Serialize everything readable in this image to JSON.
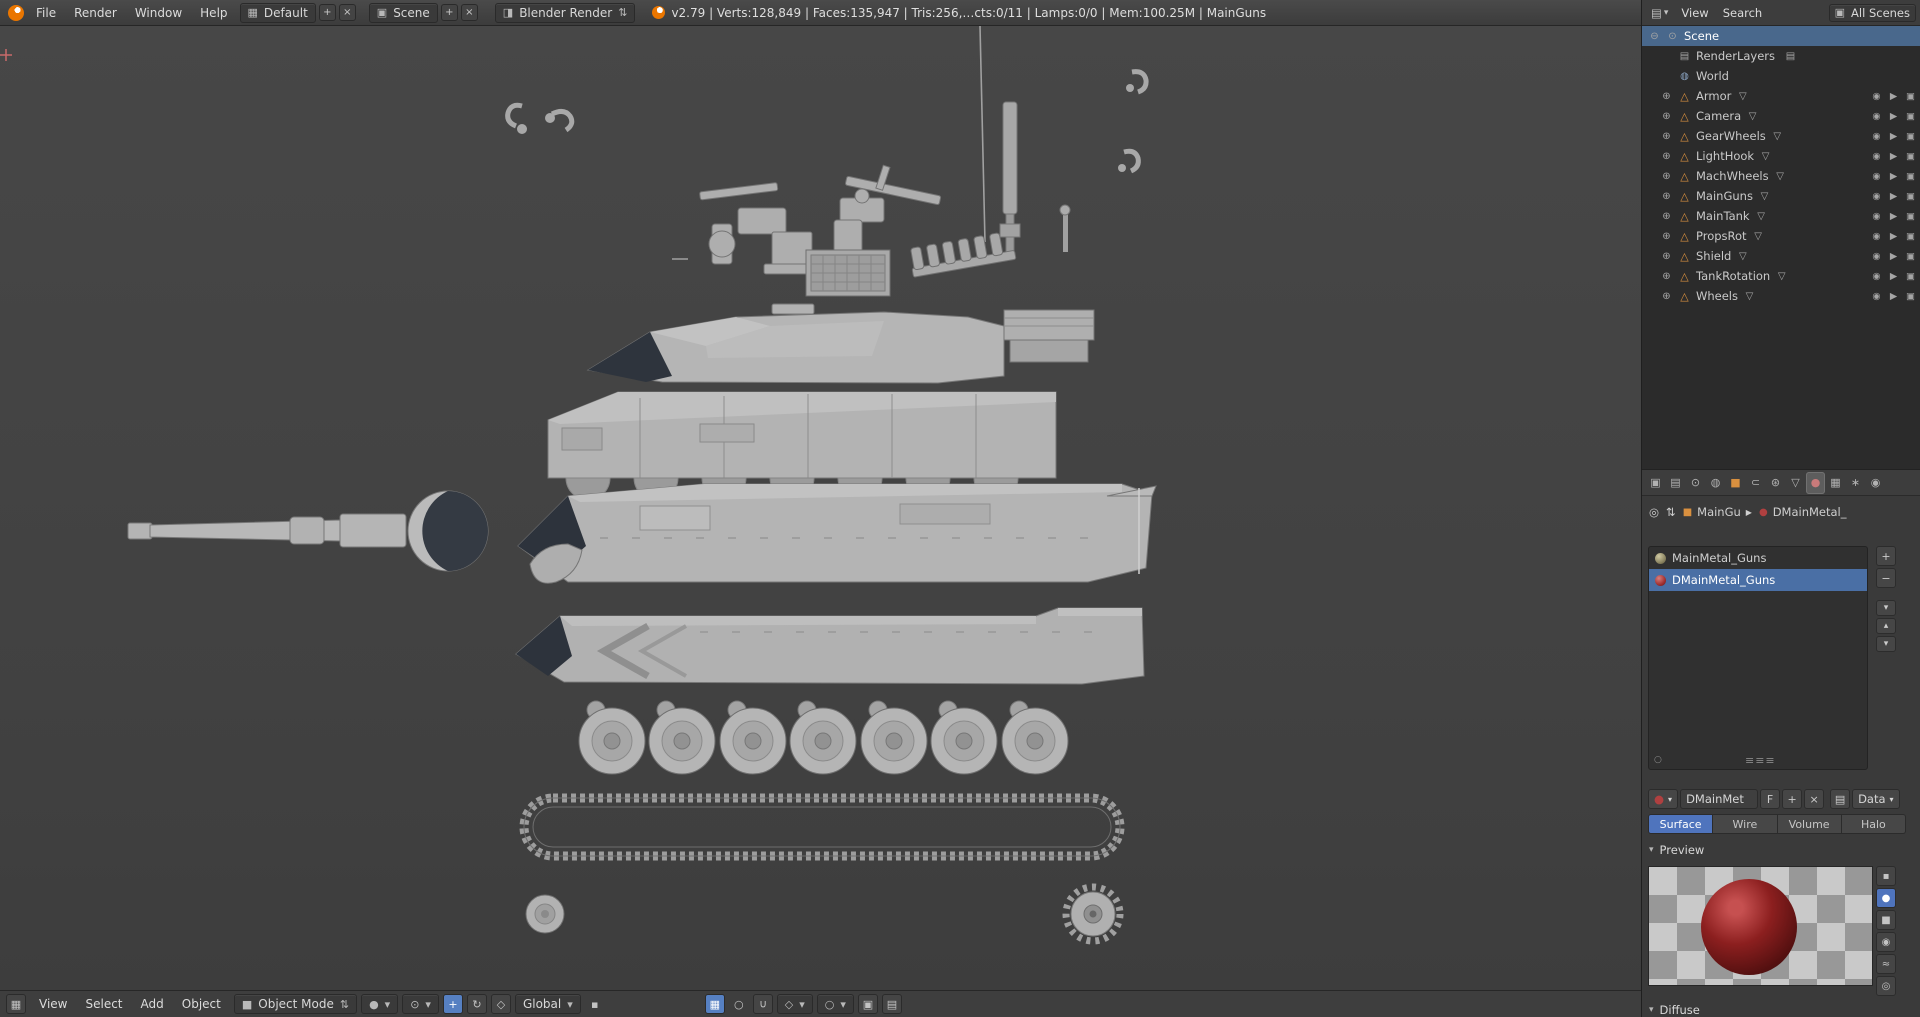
{
  "info_header": {
    "menus": [
      "File",
      "Render",
      "Window",
      "Help"
    ],
    "layout_value": "Default",
    "scene_value": "Scene",
    "engine_value": "Blender Render",
    "stats": "v2.79 | Verts:128,849 | Faces:135,947 | Tris:256,…cts:0/11 | Lamps:0/0 | Mem:100.25M | MainGuns"
  },
  "outliner": {
    "header": {
      "view": "View",
      "search": "Search",
      "scope": "All Scenes"
    },
    "scene": {
      "label": "Scene"
    },
    "children": [
      {
        "label": "RenderLayers"
      },
      {
        "label": "World"
      }
    ],
    "objects": [
      {
        "label": "Armor"
      },
      {
        "label": "Camera"
      },
      {
        "label": "GearWheels"
      },
      {
        "label": "LightHook"
      },
      {
        "label": "MachWheels"
      },
      {
        "label": "MainGuns"
      },
      {
        "label": "MainTank"
      },
      {
        "label": "PropsRot"
      },
      {
        "label": "Shield"
      },
      {
        "label": "TankRotation"
      },
      {
        "label": "Wheels"
      }
    ]
  },
  "properties": {
    "context_object": "MainGu",
    "context_material": "DMainMetal_",
    "slots": [
      {
        "name": "MainMetal_Guns"
      },
      {
        "name": "DMainMetal_Guns"
      }
    ],
    "datablock": {
      "name": "DMainMet",
      "fake_user": "F",
      "link": "Data"
    },
    "type_tabs": [
      "Surface",
      "Wire",
      "Volume",
      "Halo"
    ],
    "panels": {
      "preview": "Preview",
      "diffuse": "Diffuse"
    }
  },
  "viewport_header": {
    "menus": [
      "View",
      "Select",
      "Add",
      "Object"
    ],
    "mode": "Object Mode",
    "orientation": "Global"
  },
  "icons": {
    "expand": "⊕",
    "collapse": "⊖",
    "scene": "⊙",
    "renderlayers": "▤",
    "world": "◍",
    "mesh_object": "△",
    "mesh_data": "▽",
    "eye": "◉",
    "arrow": "▶",
    "camera": "▣",
    "dropdown": "▾",
    "updown": "⇅",
    "plus": "+",
    "minus": "−",
    "close": "×",
    "up": "▴",
    "down": "▾",
    "grip": "≡≡≡",
    "circle": "○",
    "pin": "◎",
    "layout": "▦",
    "scene_pick": "▣",
    "engine": "◨",
    "tab_render": "▣",
    "tab_layers": "▤",
    "tab_scene": "⊙",
    "tab_world": "◍",
    "tab_object": "■",
    "tab_constraints": "⊂",
    "tab_modifiers": "⊛",
    "tab_data": "▽",
    "tab_material": "●",
    "tab_texture": "▦",
    "tab_particles": "∗",
    "tab_physics": "◉",
    "nodes": "▤",
    "browse_sphere": "●",
    "prev_flat": "▪",
    "prev_sphere": "●",
    "prev_cube": "■",
    "prev_monkey": "◉",
    "prev_hair": "≈",
    "prev_world": "◎",
    "editor_3d": "▦",
    "mode_cube": "■",
    "shading": "●",
    "pivot": "⊙",
    "manip_translate": "+",
    "manip_rotate": "↻",
    "manip_scale": "◇",
    "magnet": "∩",
    "snap": "◇",
    "prop_edit": "○",
    "layers": "▦",
    "render_cam": "▣",
    "render_img": "▤"
  },
  "colors": {
    "accent_blue": "#4f74bd",
    "selected_outliner_row": "#49688c",
    "selected_slot": "#4a6fa5",
    "object_icon_orange": "#d9903f",
    "material_red": "#a13030",
    "viewport_bg": "#434343"
  }
}
